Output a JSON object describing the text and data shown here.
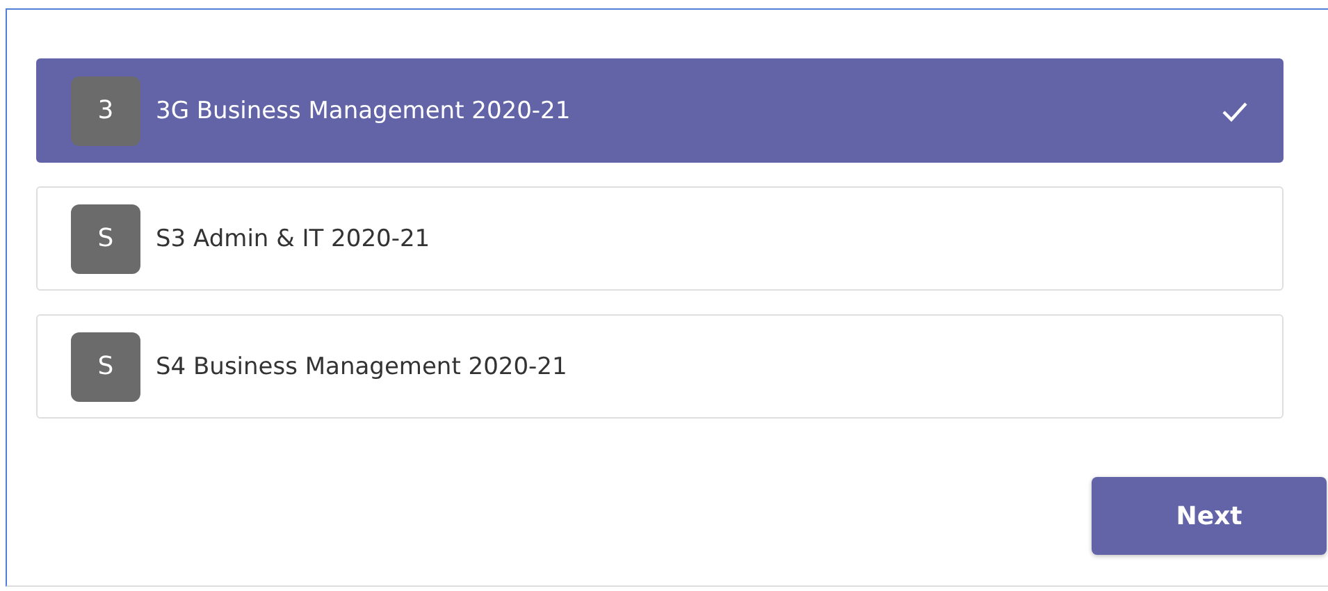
{
  "teams": [
    {
      "initial": "3",
      "name": "3G Business Management 2020-21",
      "selected": true
    },
    {
      "initial": "S",
      "name": "S3 Admin & IT 2020-21",
      "selected": false
    },
    {
      "initial": "S",
      "name": "S4 Business Management 2020-21",
      "selected": false
    }
  ],
  "next_button": {
    "label": "Next"
  }
}
